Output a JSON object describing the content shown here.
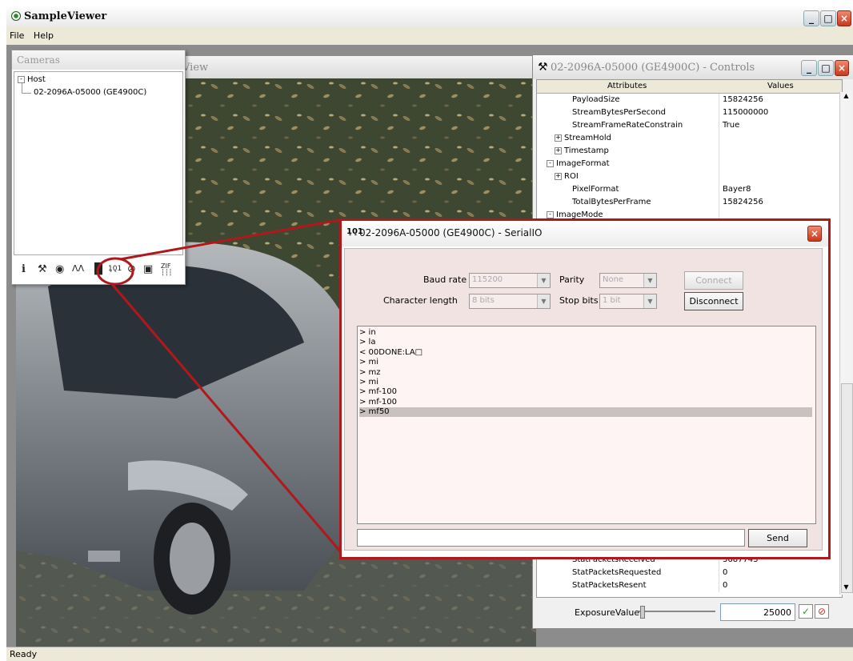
{
  "app": {
    "title": "SampleViewer",
    "menu": [
      "File",
      "Help"
    ],
    "status": "Ready"
  },
  "viewer": {
    "title": "View"
  },
  "cameras": {
    "title": "Cameras",
    "tree": {
      "root": "Host",
      "camera": "02-2096A-05000 (GE4900C)"
    },
    "toolbar_icons": [
      "info-icon",
      "wrench-icon",
      "eye-icon",
      "histogram-icon",
      "film-icon",
      "serial-io-icon",
      "no-camera-icon",
      "save-icon",
      "zif-icon"
    ]
  },
  "controls": {
    "title": "02-2096A-05000 (GE4900C) - Controls",
    "headers": {
      "attributes": "Attributes",
      "values": "Values"
    },
    "rows_top": [
      {
        "name": "PayloadSize",
        "value": "15824256",
        "level": 2,
        "pm": ""
      },
      {
        "name": "StreamBytesPerSecond",
        "value": "115000000",
        "level": 2,
        "pm": ""
      },
      {
        "name": "StreamFrameRateConstrain",
        "value": "True",
        "level": 2,
        "pm": ""
      },
      {
        "name": "StreamHold",
        "value": "",
        "level": 1,
        "pm": "+"
      },
      {
        "name": "Timestamp",
        "value": "",
        "level": 1,
        "pm": "+"
      },
      {
        "name": "ImageFormat",
        "value": "",
        "level": 0,
        "pm": "-"
      },
      {
        "name": "ROI",
        "value": "",
        "level": 1,
        "pm": "+"
      },
      {
        "name": "PixelFormat",
        "value": "Bayer8",
        "level": 2,
        "pm": ""
      },
      {
        "name": "TotalBytesPerFrame",
        "value": "15824256",
        "level": 2,
        "pm": ""
      },
      {
        "name": "ImageMode",
        "value": "",
        "level": 0,
        "pm": "-"
      }
    ],
    "rows_bottom": [
      {
        "name": "StatPacketsReceived",
        "value": "3687743",
        "level": 2,
        "pm": ""
      },
      {
        "name": "StatPacketsRequested",
        "value": "0",
        "level": 2,
        "pm": ""
      },
      {
        "name": "StatPacketsResent",
        "value": "0",
        "level": 2,
        "pm": ""
      }
    ],
    "exposure": {
      "label": "ExposureValue",
      "value": "25000",
      "slider_fraction": 0.02
    }
  },
  "serial": {
    "title": "02-2096A-05000 (GE4900C) - SerialIO",
    "baud_label": "Baud rate",
    "baud_value": "115200",
    "parity_label": "Parity",
    "parity_value": "None",
    "charlen_label": "Character length",
    "charlen_value": "8 bits",
    "stopbits_label": "Stop bits",
    "stopbits_value": "1 bit",
    "connect_label": "Connect",
    "disconnect_label": "Disconnect",
    "send_label": "Send",
    "log": [
      "> in",
      "> la",
      "< 00DONE:LA□",
      "> mi",
      "> mz",
      "> mi",
      "> mf-100",
      "> mf-100",
      "> mf50"
    ],
    "selected_index": 8
  },
  "colors": {
    "callout": "#b0181c",
    "dialog_bg": "#f2e3e3"
  }
}
